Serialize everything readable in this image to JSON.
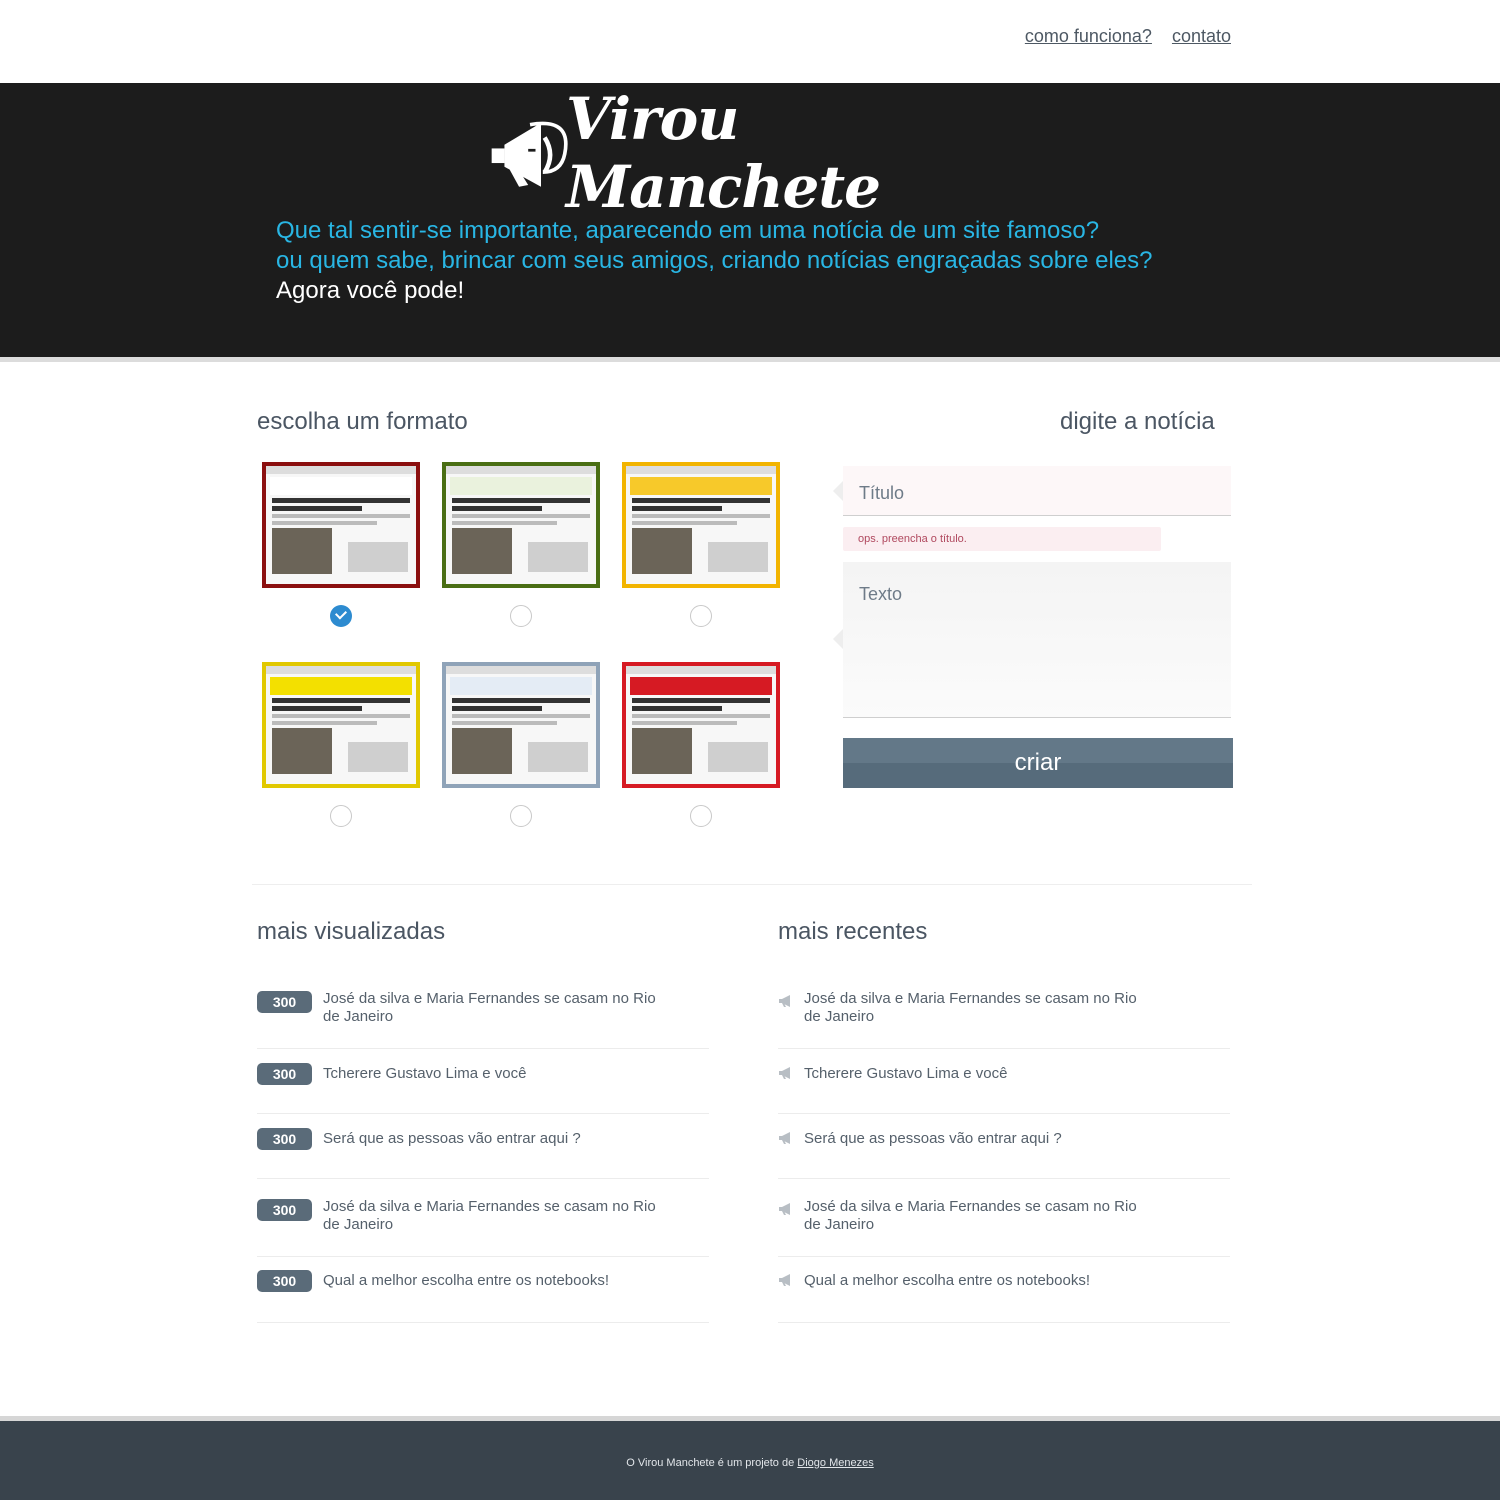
{
  "nav": {
    "how_it_works": "como funciona?",
    "contact": "contato"
  },
  "hero": {
    "brand": "Virou Manchete",
    "tagline_line1": "Que tal sentir-se importante, aparecendo em uma notícia de um site famoso?",
    "tagline_line2": "ou quem sabe, brincar com seus amigos, criando notícias engraçadas sobre eles?",
    "tagline_line3": "Agora você pode!",
    "colors": {
      "accent_blue": "#29b6e4",
      "dark_bg": "#1c1c1c"
    }
  },
  "formats": {
    "title": "escolha um formato",
    "selected_index": 0,
    "items": [
      {
        "name": "g1",
        "border": "#8b0f0f",
        "header": "#ffffff",
        "selected": true
      },
      {
        "name": "globoesporte",
        "border": "#4a6e14",
        "header": "#eaf2dd",
        "selected": false
      },
      {
        "name": "lancenet",
        "border": "#f2b400",
        "header": "#f7c92a",
        "selected": false
      },
      {
        "name": "odia",
        "border": "#e1c800",
        "header": "#f3e000",
        "selected": false
      },
      {
        "name": "ego",
        "border": "#8fa3b8",
        "header": "#e4ecf5",
        "selected": false
      },
      {
        "name": "caras",
        "border": "#d61a23",
        "header": "#d61a23",
        "selected": false
      }
    ]
  },
  "form": {
    "title": "digite a notícia",
    "title_placeholder": "Título",
    "title_error": "ops. preencha o título.",
    "text_placeholder": "Texto",
    "submit": "criar"
  },
  "most_viewed": {
    "title": "mais visualizadas",
    "items": [
      {
        "count": "300",
        "text": "José da silva e Maria Fernandes se casam no Rio de Janeiro"
      },
      {
        "count": "300",
        "text": "Tcherere Gustavo Lima e você"
      },
      {
        "count": "300",
        "text": "Será que as pessoas vão entrar aqui ?"
      },
      {
        "count": "300",
        "text": "José da silva e Maria Fernandes se casam no Rio de Janeiro"
      },
      {
        "count": "300",
        "text": "Qual a melhor escolha entre os notebooks!"
      }
    ]
  },
  "most_recent": {
    "title": "mais recentes",
    "items": [
      {
        "text": "José da silva e Maria Fernandes se casam no Rio de Janeiro"
      },
      {
        "text": "Tcherere Gustavo Lima e você"
      },
      {
        "text": "Será que as pessoas vão entrar aqui ?"
      },
      {
        "text": "José da silva e Maria Fernandes se casam no Rio de Janeiro"
      },
      {
        "text": "Qual a melhor escolha entre os notebooks!"
      }
    ]
  },
  "footer": {
    "prefix": "O Virou Manchete é um projeto de ",
    "author": "Diogo Menezes"
  }
}
